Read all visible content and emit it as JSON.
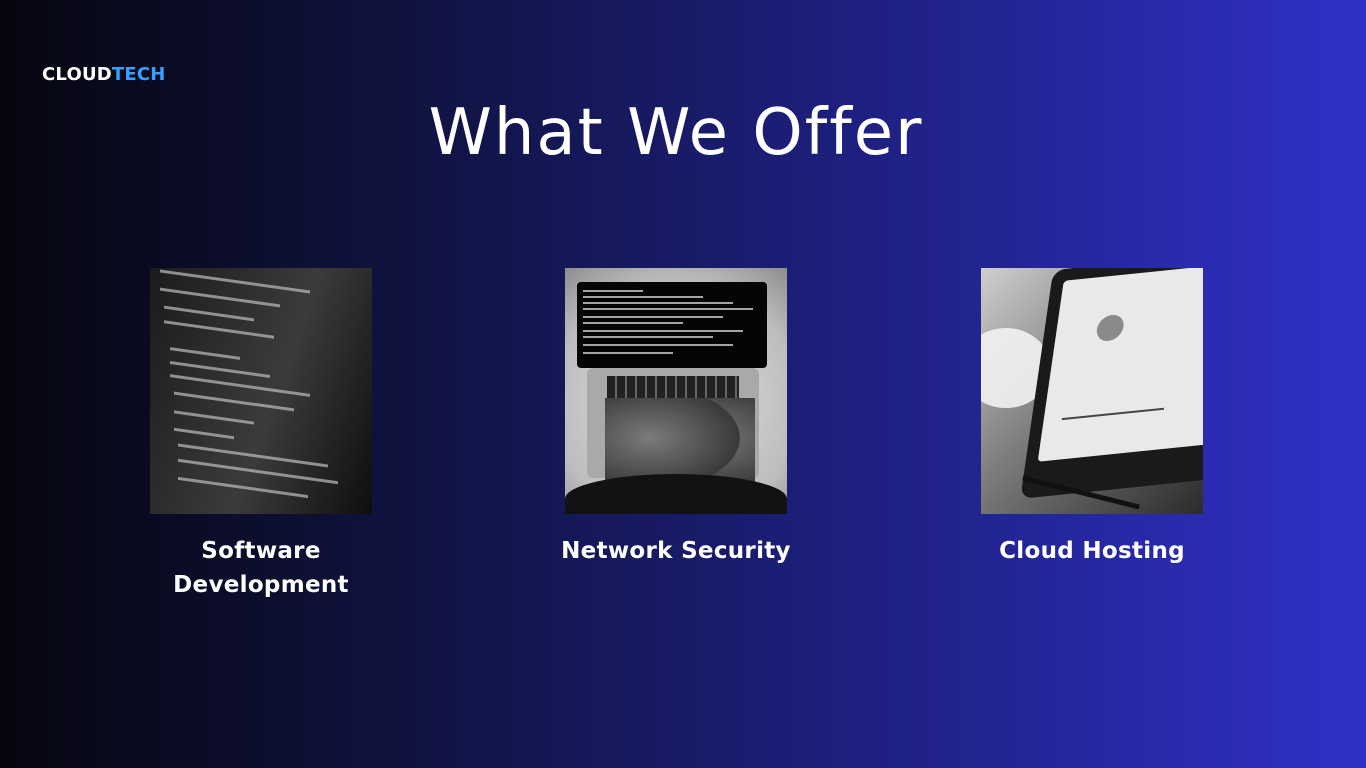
{
  "brand": {
    "part1": "CLOUD",
    "part2": "TECH"
  },
  "title": "What We Offer",
  "services": [
    {
      "label": "Software\nDevelopment",
      "line1": "Software",
      "line2": "Development",
      "image": "code-editor-photo"
    },
    {
      "label": "Network Security",
      "image": "laptop-terminal-photo"
    },
    {
      "label": "Cloud Hosting",
      "image": "tablet-dashboard-photo"
    }
  ],
  "colors": {
    "accent": "#3aa0ff",
    "bg_start": "#06060f",
    "bg_end": "#3030c8"
  }
}
